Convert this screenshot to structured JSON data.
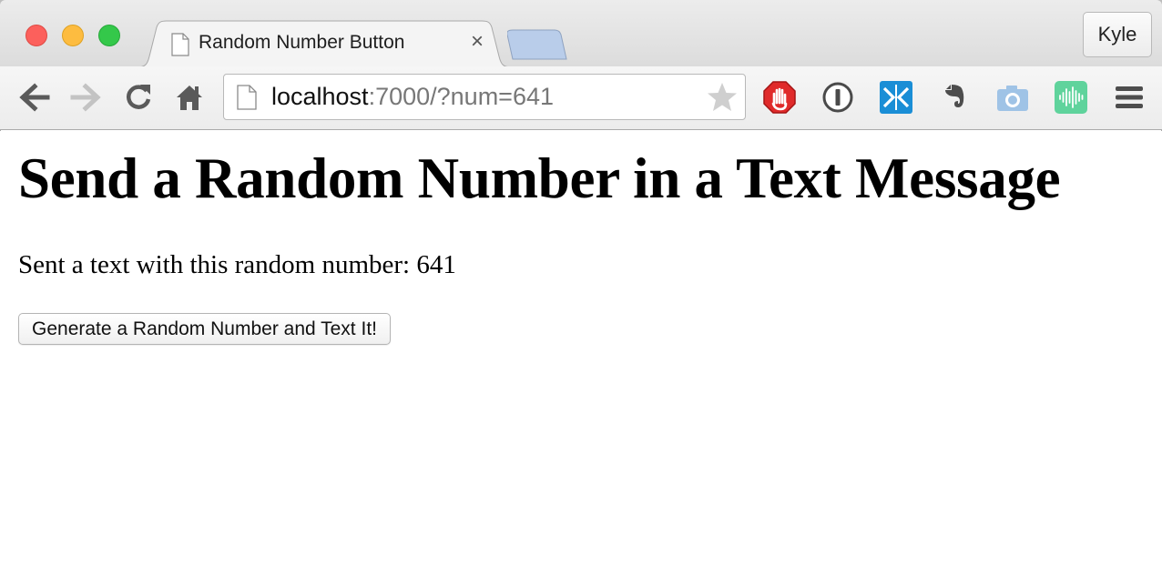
{
  "browser": {
    "tab": {
      "title": "Random Number Button",
      "close_glyph": "×",
      "favicon": "page-icon"
    },
    "profile_name": "Kyle",
    "toolbar": {
      "back_icon": "back-arrow-icon",
      "forward_icon": "forward-arrow-icon",
      "reload_icon": "reload-icon",
      "home_icon": "home-icon",
      "address": {
        "host": "localhost",
        "rest": ":7000/?num=641"
      },
      "bookmark_icon": "star-icon",
      "extensions": [
        "adblock-hand-icon",
        "1password-icon",
        "split-tab-icon",
        "evernote-icon",
        "camera-icon",
        "audio-wave-icon"
      ],
      "menu_icon": "hamburger-menu-icon"
    }
  },
  "page": {
    "heading": "Send a Random Number in a Text Message",
    "result_text": "Sent a text with this random number: 641",
    "button_label": "Generate a Random Number and Text It!"
  },
  "colors": {
    "close": "#fc605c",
    "minimize": "#fdbc40",
    "zoom": "#34c84a",
    "adblock": "#e02a2a",
    "split_tab": "#1a8ed6",
    "audio_ext": "#5fd39c"
  }
}
